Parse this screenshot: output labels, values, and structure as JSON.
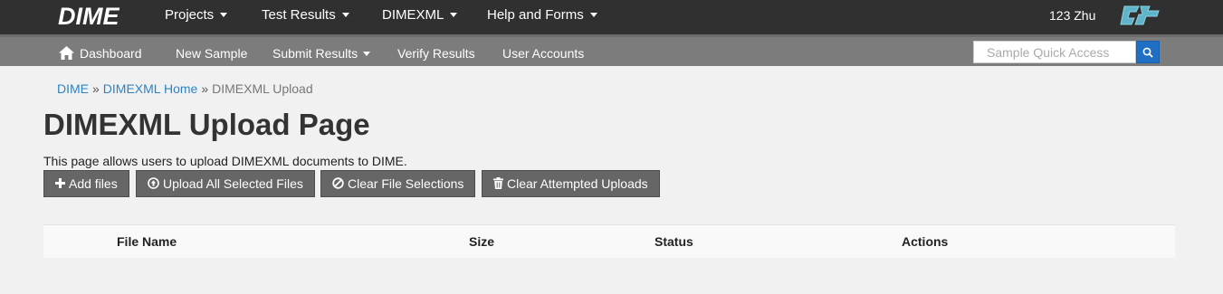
{
  "app": {
    "logo_text": "DIME",
    "user": "123 Zhu"
  },
  "topnav": {
    "items": [
      {
        "label": "Projects"
      },
      {
        "label": "Test Results"
      },
      {
        "label": "DIMEXML"
      },
      {
        "label": "Help and Forms"
      }
    ]
  },
  "subnav": {
    "dashboard": "Dashboard",
    "new_sample": "New Sample",
    "submit_results": "Submit Results",
    "verify_results": "Verify Results",
    "user_accounts": "User Accounts",
    "search_placeholder": "Sample Quick Access"
  },
  "breadcrumb": {
    "items": [
      "DIME",
      "DIMEXML Home",
      "DIMEXML Upload"
    ],
    "separator": "»"
  },
  "page": {
    "title": "DIMEXML Upload Page",
    "description": "This page allows users to upload DIMEXML documents to DIME."
  },
  "buttons": {
    "add_files": "Add files",
    "upload_all": "Upload All Selected Files",
    "clear_selections": "Clear File Selections",
    "clear_attempted": "Clear Attempted Uploads"
  },
  "table": {
    "headers": [
      "File Name",
      "Size",
      "Status",
      "Actions"
    ]
  },
  "colors": {
    "topbar": "#303030",
    "subbar": "#7c7c7c",
    "link": "#2d84c4",
    "search_button": "#1f6fc5",
    "button": "#666666",
    "ct_logo": "#5fb4c9"
  },
  "icons": {
    "home": "home-icon",
    "search": "search-icon",
    "plus": "plus-icon",
    "upload": "circle-arrow-up-icon",
    "ban": "ban-icon",
    "trash": "trash-icon",
    "caltrans": "caltrans-logo-icon"
  }
}
